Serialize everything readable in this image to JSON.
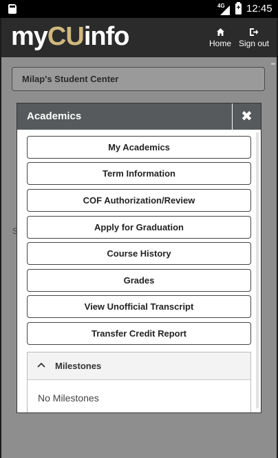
{
  "status_bar": {
    "network": "4G",
    "battery_level": "+",
    "time": "12:45"
  },
  "header": {
    "brand_prefix": "my",
    "brand_cu": "CU",
    "brand_suffix": "info",
    "home_label": "Home",
    "signout_label": "Sign out"
  },
  "page": {
    "student_center_title": "Milap's Student Center",
    "obscured_letter": "S"
  },
  "modal": {
    "title": "Academics",
    "close_glyph": "✖",
    "items": [
      "My Academics",
      "Term Information",
      "COF Authorization/Review",
      "Apply for Graduation",
      "Course History",
      "Grades",
      "View Unofficial Transcript",
      "Transfer Credit Report"
    ],
    "milestones": {
      "title": "Milestones",
      "empty_text": "No Milestones"
    }
  },
  "colors": {
    "brand_gold": "#cfb87c",
    "header_bg": "#2b2b2b",
    "modal_header_bg": "#565a5c"
  }
}
